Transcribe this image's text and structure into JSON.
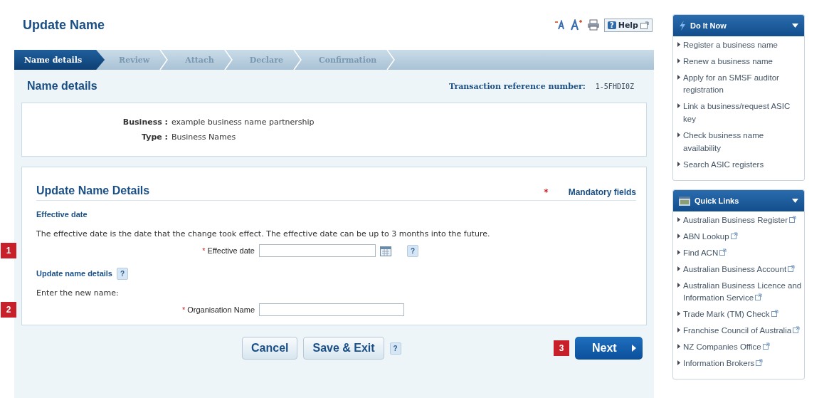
{
  "page_title": "Update Name",
  "toolbar": {
    "help_mark": "?",
    "help_label": "Help"
  },
  "steps": [
    {
      "label": "Name details",
      "selected": true
    },
    {
      "label": "Review",
      "selected": false
    },
    {
      "label": "Attach",
      "selected": false
    },
    {
      "label": "Declare",
      "selected": false
    },
    {
      "label": "Confirmation",
      "selected": false
    }
  ],
  "section": {
    "title": "Name details",
    "reference_label": "Transaction reference number:",
    "reference_value": "1-5FHDI0Z"
  },
  "summary": [
    {
      "label": "Business :",
      "value": "example business name partnership"
    },
    {
      "label": "Type :",
      "value": "Business Names"
    }
  ],
  "form": {
    "title": "Update Name Details",
    "mandatory_mark": "*",
    "mandatory_label": "Mandatory fields",
    "groups": [
      {
        "heading": "Effective date",
        "text": "The effective date is the date that the change took effect. The effective date can be up to 3 months into the future.",
        "field": {
          "kind": "date",
          "mark": "*",
          "label": "Effective date",
          "help": "?",
          "marker": "1"
        }
      },
      {
        "heading": "Update name details",
        "heading_help": "?",
        "text": "Enter the new name:",
        "field": {
          "kind": "text",
          "mark": "*",
          "label": "Organisation Name",
          "marker": "2"
        }
      }
    ]
  },
  "buttons": {
    "cancel": "Cancel",
    "save": "Save & Exit",
    "save_help": "?",
    "marker": "3",
    "next": "Next"
  },
  "sidebar": [
    {
      "title": "Do It Now",
      "kind": "actions",
      "items": [
        {
          "label": "Register a business name",
          "external": false
        },
        {
          "label": "Renew a business name",
          "external": false
        },
        {
          "label": "Apply for an SMSF auditor registration",
          "external": false
        },
        {
          "label": "Link a business/request ASIC key",
          "external": false
        },
        {
          "label": "Check business name availability",
          "external": false
        },
        {
          "label": "Search ASIC registers",
          "external": false
        }
      ]
    },
    {
      "title": "Quick Links",
      "kind": "links",
      "items": [
        {
          "label": "Australian Business Register",
          "external": true
        },
        {
          "label": "ABN Lookup",
          "external": true
        },
        {
          "label": "Find ACN",
          "external": true
        },
        {
          "label": "Australian Business Account",
          "external": true
        },
        {
          "label": "Australian Business Licence and Information Service",
          "external": true
        },
        {
          "label": "Trade Mark (TM) Check",
          "external": true
        },
        {
          "label": "Franchise Council of Australia",
          "external": true
        },
        {
          "label": "NZ Companies Office",
          "external": true
        },
        {
          "label": "Information Brokers",
          "external": true
        }
      ]
    }
  ]
}
